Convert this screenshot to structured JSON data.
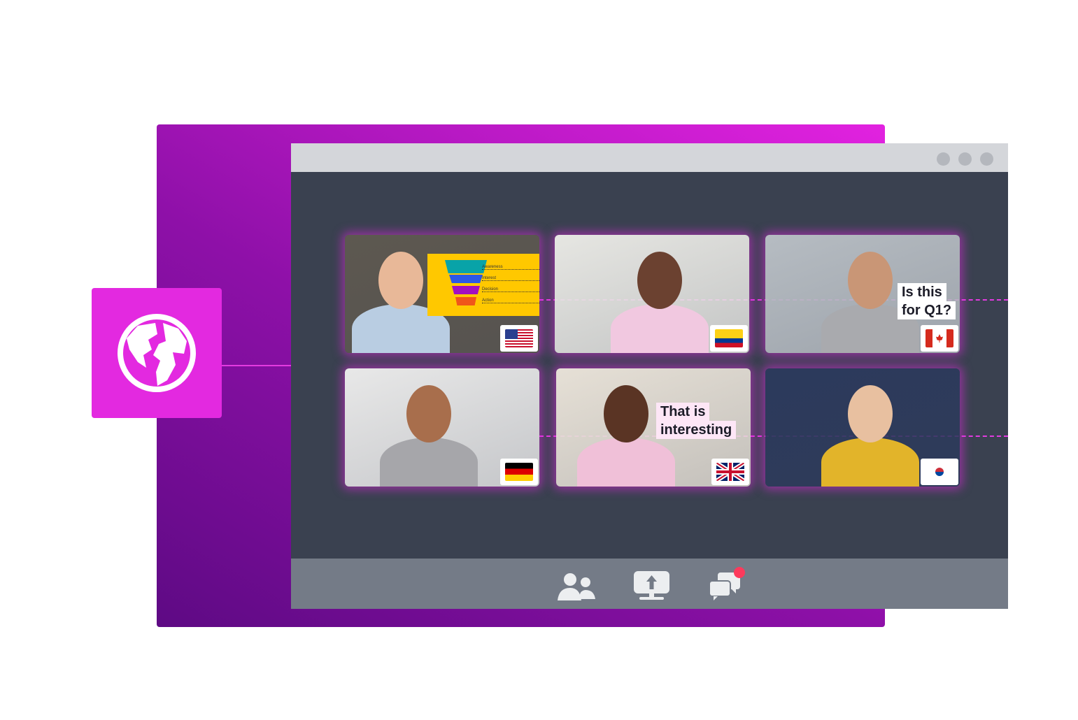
{
  "captions": {
    "tile3": "Is this\nfor Q1?",
    "tile5": "That is\ninteresting"
  },
  "funnel": {
    "stages": [
      "Awareness",
      "Interest",
      "Decision",
      "Action"
    ],
    "colors": [
      "#08a3a8",
      "#2c58e6",
      "#a40fc0",
      "#f0561a"
    ],
    "background": "#ffc800"
  },
  "participants": [
    {
      "flag": "United States",
      "skin": "#e8b898",
      "shirt": "#b9cde2",
      "bg": "#5d5850"
    },
    {
      "flag": "Colombia",
      "skin": "#6b4130",
      "shirt": "#f1c8e0",
      "bg": "#e6e6e2"
    },
    {
      "flag": "Canada",
      "skin": "#c99676",
      "shirt": "#a9aaae",
      "bg": "#b6bcc2"
    },
    {
      "flag": "Germany",
      "skin": "#a86e4c",
      "shirt": "#a6a6aa",
      "bg": "#e8e8e8"
    },
    {
      "flag": "United Kingdom",
      "skin": "#5a3424",
      "shirt": "#f0c0d8",
      "bg": "#e6e0d6"
    },
    {
      "flag": "South Korea",
      "skin": "#e8c0a0",
      "shirt": "#e2b42a",
      "bg": "#2c3a5c"
    }
  ],
  "toolbar": {
    "icons": [
      "participants-icon",
      "share-screen-icon",
      "chat-icon"
    ],
    "notification_color": "#fd3a5c"
  },
  "colors": {
    "accent": "#e329e0",
    "window_body": "#3a4150",
    "titlebar": "#d4d6da",
    "bottombar": "#747b87"
  }
}
